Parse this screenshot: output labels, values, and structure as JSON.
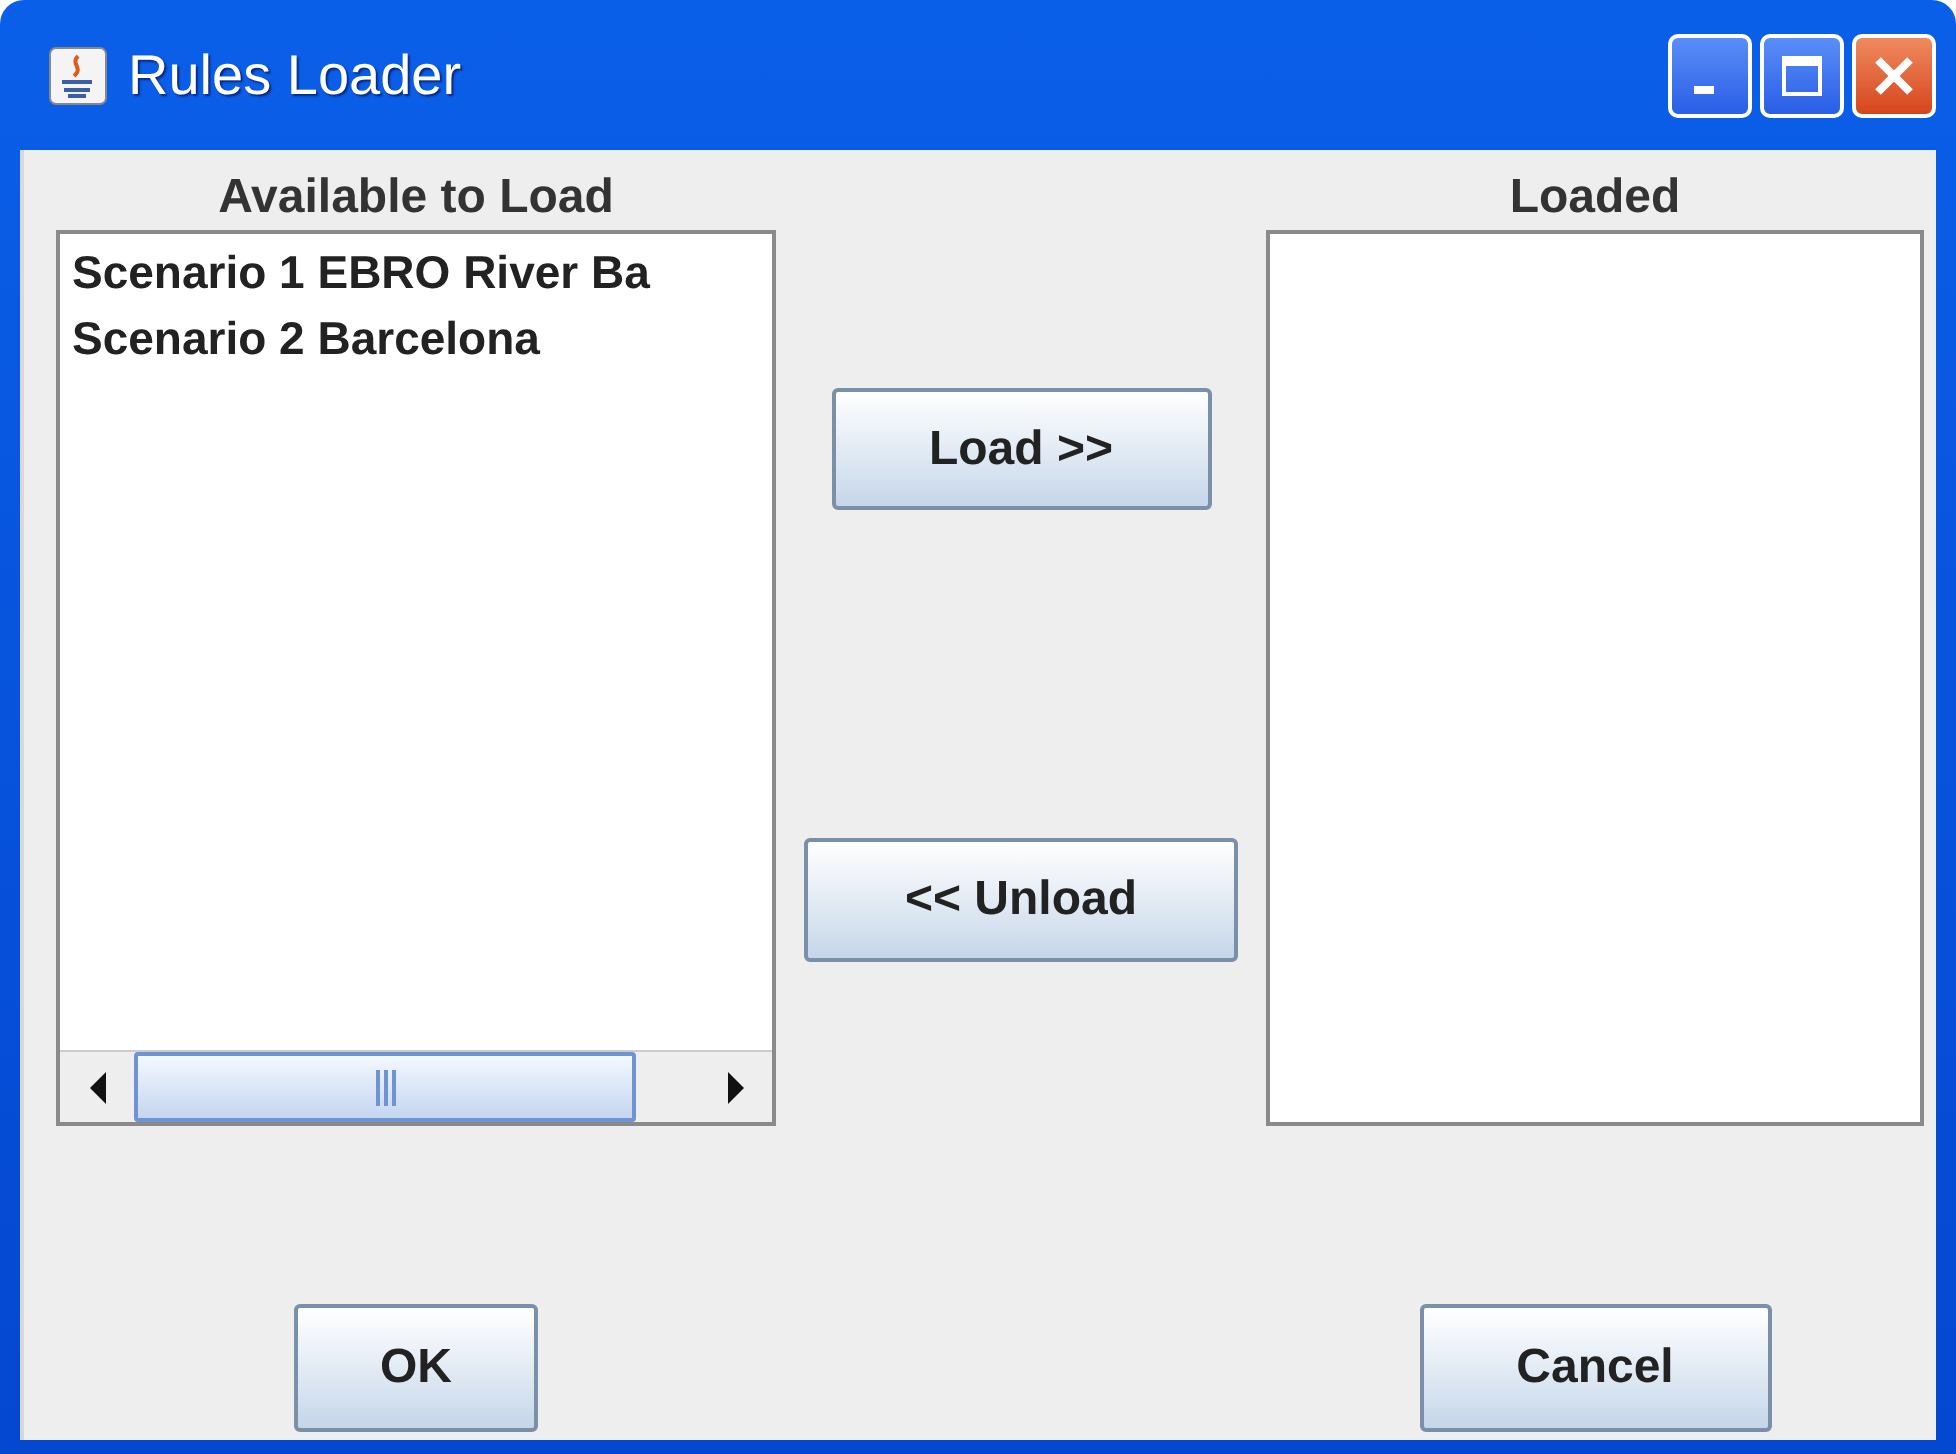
{
  "window": {
    "title": "Rules Loader"
  },
  "available": {
    "label": "Available to Load",
    "items": [
      {
        "text": "Scenario 1 EBRO River Ba"
      },
      {
        "text": "Scenario 2 Barcelona"
      }
    ]
  },
  "loaded": {
    "label": "Loaded"
  },
  "move_buttons": {
    "load": "Load >>",
    "unload": "<< Unload"
  },
  "dialog_buttons": {
    "ok": "OK",
    "cancel": "Cancel"
  }
}
